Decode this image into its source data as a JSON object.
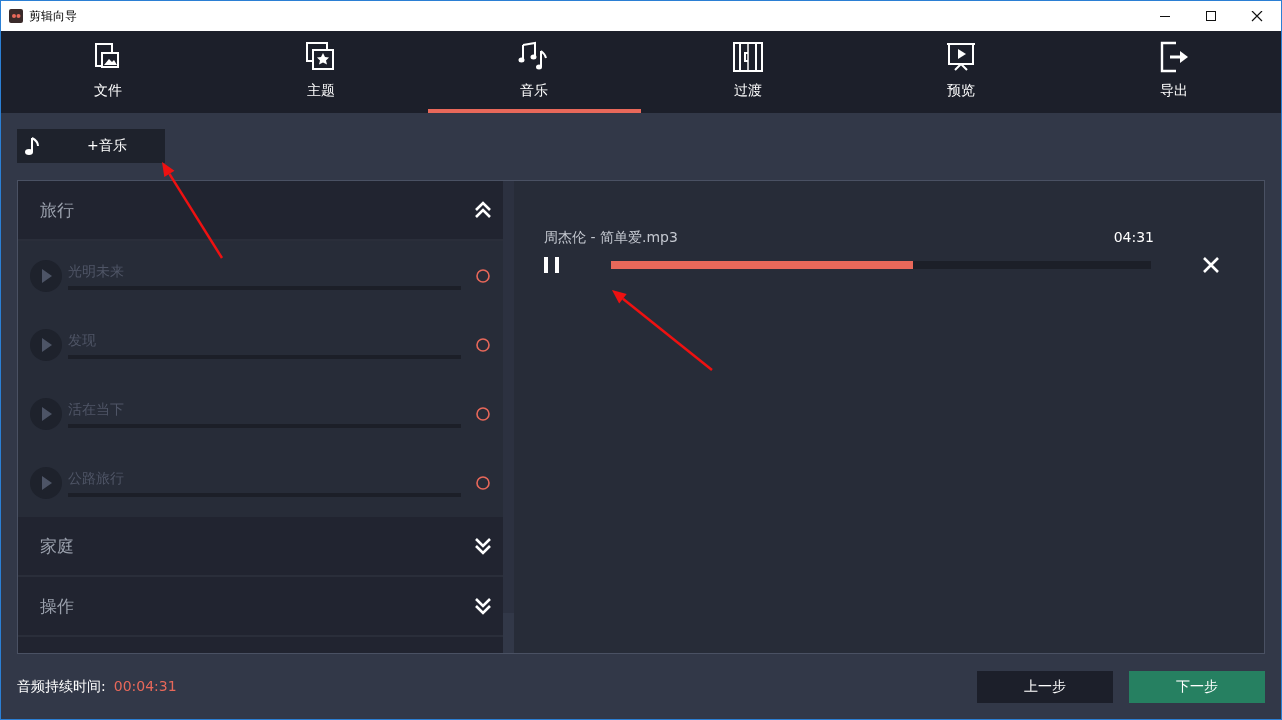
{
  "window": {
    "title": "剪辑向导"
  },
  "tabs": [
    {
      "label": "文件",
      "selected": false
    },
    {
      "label": "主题",
      "selected": false
    },
    {
      "label": "音乐",
      "selected": true
    },
    {
      "label": "过渡",
      "selected": false
    },
    {
      "label": "预览",
      "selected": false
    },
    {
      "label": "导出",
      "selected": false
    }
  ],
  "add_music_button": "+音乐",
  "categories": [
    {
      "title": "旅行",
      "expanded": true,
      "tracks": [
        {
          "name": "光明未来"
        },
        {
          "name": "发现"
        },
        {
          "name": "活在当下"
        },
        {
          "name": "公路旅行"
        }
      ]
    },
    {
      "title": "家庭",
      "expanded": false
    },
    {
      "title": "操作",
      "expanded": false
    }
  ],
  "selected_music": [
    {
      "file": "周杰伦 - 简单爱.mp3",
      "duration": "04:31",
      "playing": true,
      "level": 0.56
    }
  ],
  "footer": {
    "label": "音频持续时间:",
    "value": "00:04:31"
  },
  "buttons": [
    {
      "label": "上一步",
      "kind": "secondary"
    },
    {
      "label": "下一步",
      "kind": "primary"
    }
  ],
  "annotations": [
    {
      "kind": "arrow"
    },
    {
      "kind": "arrow"
    }
  ]
}
